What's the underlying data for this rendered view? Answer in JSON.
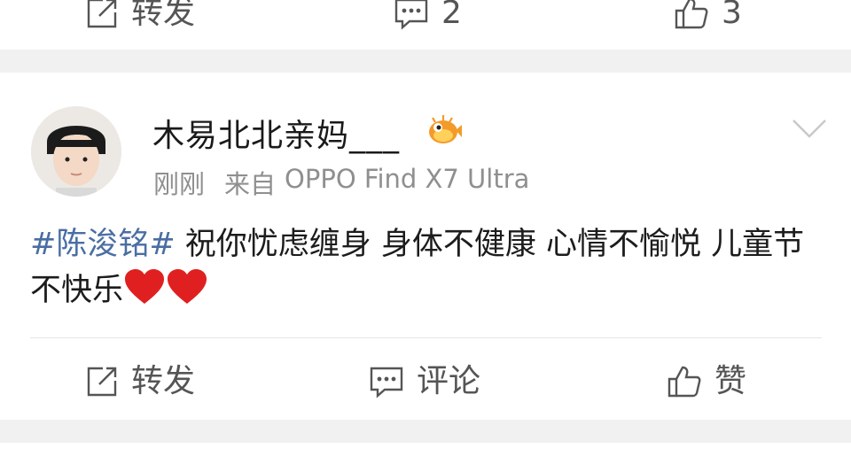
{
  "previous_post": {
    "repost_label": "转发",
    "comment_count": "2",
    "like_count": "3"
  },
  "post": {
    "username": "木易北北亲妈___",
    "badge_icon": "pufferfish-badge-icon",
    "time": "刚刚",
    "source_prefix": "来自",
    "source_device": "OPPO Find X7 Ultra",
    "topic": "#陈浚铭#",
    "text_main": " 祝你忧虑缠身 身体不健康 心情不愉悦 儿童节不快乐",
    "emoji": "❤️❤️",
    "actions": {
      "repost_label": "转发",
      "comment_label": "评论",
      "like_label": "赞"
    }
  },
  "colors": {
    "topic_link": "#4a6ea3",
    "meta_text": "#8f8f8f",
    "divider_band": "#f1f1f1"
  }
}
